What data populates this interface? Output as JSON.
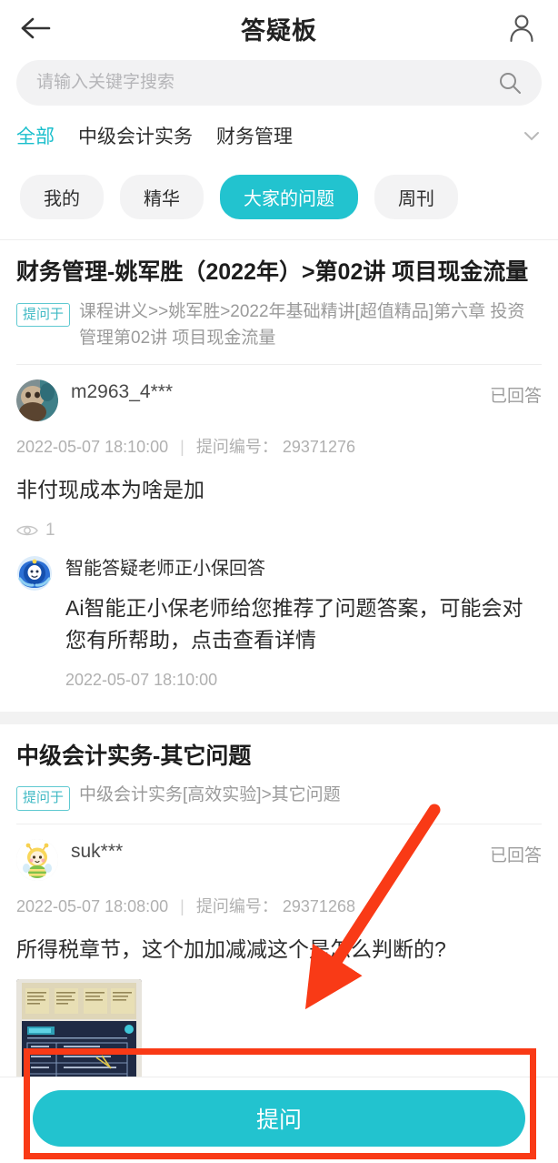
{
  "header": {
    "title": "答疑板",
    "back_icon": "arrow-left-icon",
    "user_icon": "user-account-icon"
  },
  "search": {
    "placeholder": "请输入关键字搜索",
    "value": "",
    "icon": "search-icon"
  },
  "categories": {
    "items": [
      {
        "label": "全部",
        "active": true
      },
      {
        "label": "中级会计实务",
        "active": false
      },
      {
        "label": "财务管理",
        "active": false
      }
    ],
    "expand_icon": "chevron-down-icon"
  },
  "filter_chips": [
    {
      "label": "我的",
      "active": false
    },
    {
      "label": "精华",
      "active": false
    },
    {
      "label": "大家的问题",
      "active": true
    },
    {
      "label": "周刊",
      "active": false
    }
  ],
  "threads": [
    {
      "title": "财务管理-姚军胜（2022年）>第02讲 项目现金流量",
      "ask_badge": "提问于",
      "source_path": "课程讲义>>姚军胜>2022年基础精讲[超值精品]第六章 投资管理第02讲 项目现金流量",
      "question": {
        "username": "m2963_4***",
        "status": "已回答",
        "timestamp": "2022-05-07 18:10:00",
        "id_label": "提问编号：",
        "id_value": "29371276",
        "text": "非付现成本为啥是加",
        "views_icon": "eye-icon",
        "views": "1"
      },
      "reply": {
        "title": "智能答疑老师正小保回答",
        "text": "Ai智能正小保老师给您推荐了问题答案，可能会对您有所帮助，点击查看详情",
        "timestamp": "2022-05-07 18:10:00",
        "avatar_icon": "ai-assistant-avatar-icon"
      }
    },
    {
      "title": "中级会计实务-其它问题",
      "ask_badge": "提问于",
      "source_path": "中级会计实务[高效实验]>其它问题",
      "question": {
        "username": "suk***",
        "status": "已回答",
        "timestamp": "2022-05-07 18:08:00",
        "id_label": "提问编号：",
        "id_value": "29371268",
        "text": "所得税章节，这个加加减减这个是怎么判断的?",
        "attachment_icon": "image-attachment-thumbnail"
      }
    }
  ],
  "bottom": {
    "ask_label": "提问"
  },
  "colors": {
    "accent": "#22c3cf",
    "annotation": "#f93a16",
    "text_primary": "#2b2b2b",
    "text_muted": "#b0b0b0",
    "page_bg": "#f2f2f2"
  }
}
